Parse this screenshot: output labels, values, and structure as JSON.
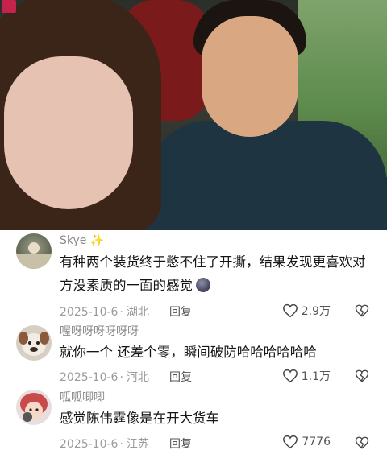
{
  "comments": [
    {
      "username": "Skye",
      "username_suffix": "✨",
      "text": "有种两个装货终于憋不住了开撕，结果发现更喜欢对方没素质的一面的感觉",
      "date": "2025-10-6",
      "location": "湖北",
      "reply_label": "回复",
      "likes": "2.9万"
    },
    {
      "username": "喔呀呀呀呀呀呀",
      "username_suffix": "",
      "text": "就你一个 还差个零，瞬间破防哈哈哈哈哈哈",
      "date": "2025-10-6",
      "location": "河北",
      "reply_label": "回复",
      "likes": "1.1万"
    },
    {
      "username": "呱呱唧唧",
      "username_suffix": "",
      "text": "感觉陈伟霆像是在开大货车",
      "date": "2025-10-6",
      "location": "江苏",
      "reply_label": "回复",
      "likes": "7776"
    }
  ]
}
